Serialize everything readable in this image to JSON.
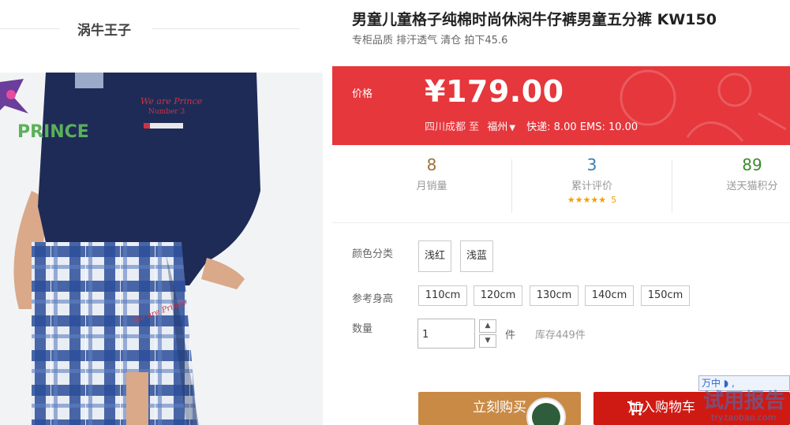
{
  "shop": {
    "name": "涡牛王子"
  },
  "product": {
    "title": "男童儿童格子纯棉时尚休闲牛仔裤男童五分裤 KW150",
    "subtitle": "专柜品质 排汗透气 清仓 拍下45.6",
    "image_brand_text": "PRINCE"
  },
  "price": {
    "label": "价格",
    "value": "¥179.00",
    "from": "四川成都",
    "to_label": "至",
    "destination": "福州",
    "shipping": "快递: 8.00 EMS: 10.00"
  },
  "stats": [
    {
      "value": "8",
      "label": "月销量",
      "color": "#a0703a"
    },
    {
      "value": "3",
      "label": "累计评价",
      "color": "#3a7fb0",
      "stars": "★★★★★",
      "rating": "5"
    },
    {
      "value": "89",
      "label": "送天猫积分",
      "color": "#3c8a2e"
    }
  ],
  "options": {
    "color_label": "颜色分类",
    "colors": [
      "浅红",
      "浅蓝"
    ],
    "height_label": "参考身高",
    "heights": [
      "110cm",
      "120cm",
      "130cm",
      "140cm",
      "150cm"
    ],
    "quantity_label": "数量",
    "quantity_value": "1",
    "unit": "件",
    "stock": "库存449件"
  },
  "actions": {
    "buy_label": "立刻购买",
    "cart_label": "加入购物车"
  },
  "overlay": {
    "ime_text": "万中 ◗ ,",
    "watermark": "试用报告",
    "watermark_url": "try.taobao.com"
  },
  "colors": {
    "price_red": "#e5373c",
    "buy_button": "#c98a45",
    "cart_button": "#cf1a13"
  }
}
